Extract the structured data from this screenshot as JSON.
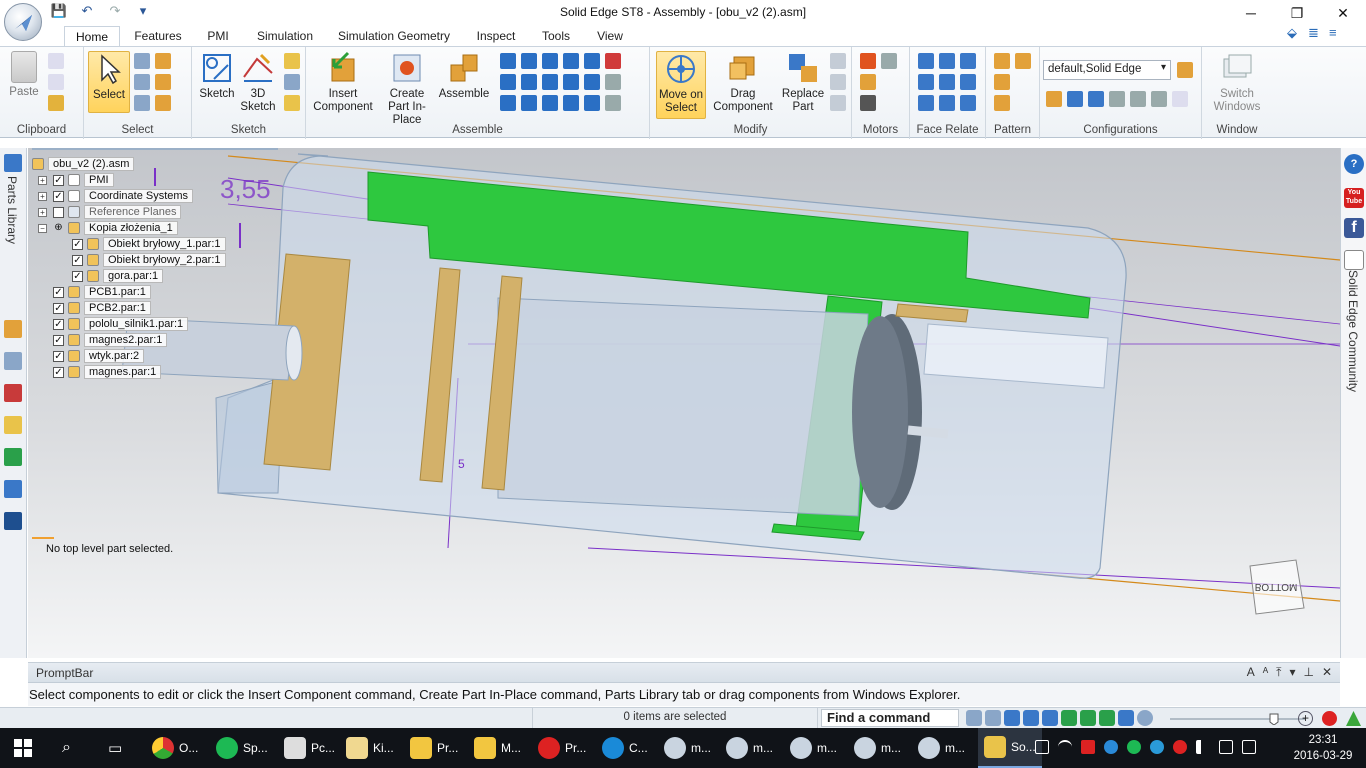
{
  "window": {
    "title": "Solid Edge ST8 - Assembly - [obu_v2 (2).asm]",
    "minimize": "─",
    "restore": "❐",
    "close": "✕"
  },
  "qat": {
    "save": "💾",
    "undo": "↶",
    "redo": "↷",
    "more": "▾"
  },
  "tabs": [
    "Home",
    "Features",
    "PMI",
    "Simulation",
    "Simulation Geometry",
    "Inspect",
    "Tools",
    "View"
  ],
  "ribbon": {
    "clipboard": {
      "paste": "Paste",
      "label": "Clipboard"
    },
    "select": {
      "select": "Select",
      "label": "Select"
    },
    "sketch": {
      "sketch": "Sketch",
      "sketch3d": "3D Sketch",
      "label": "Sketch"
    },
    "assemble": {
      "insert": "Insert Component",
      "create": "Create Part In-Place",
      "assemble": "Assemble",
      "label": "Assemble"
    },
    "modify": {
      "move": "Move on Select",
      "drag": "Drag Component",
      "replace": "Replace Part",
      "label": "Modify"
    },
    "motors": {
      "label": "Motors"
    },
    "face_relate": {
      "label": "Face Relate"
    },
    "pattern": {
      "label": "Pattern"
    },
    "configurations": {
      "value": "default,Solid Edge",
      "label": "Configurations"
    },
    "window": {
      "switch": "Switch Windows",
      "label": "Window"
    }
  },
  "left_bar": {
    "parts_library": "Parts Library"
  },
  "right_bar": {
    "community": "Solid Edge Community",
    "youtube": "You Tube",
    "facebook": "f",
    "help": "?"
  },
  "tree": {
    "root": "obu_v2 (2).asm",
    "items": [
      {
        "label": "PMI",
        "checked": true
      },
      {
        "label": "Coordinate Systems",
        "checked": true
      },
      {
        "label": "Reference Planes",
        "checked": false
      },
      {
        "label": "Kopia złożenia_1",
        "checked": true
      },
      {
        "label": "Obiekt bryłowy_1.par:1",
        "checked": true
      },
      {
        "label": "Obiekt bryłowy_2.par:1",
        "checked": true
      },
      {
        "label": "gora.par:1",
        "checked": true
      },
      {
        "label": "PCB1.par:1",
        "checked": true
      },
      {
        "label": "PCB2.par:1",
        "checked": true
      },
      {
        "label": "pololu_silnik1.par:1",
        "checked": true
      },
      {
        "label": "magnes2.par:1",
        "checked": true
      },
      {
        "label": "wtyk.par:2",
        "checked": true
      },
      {
        "label": "magnes.par:1",
        "checked": true
      }
    ]
  },
  "viewport": {
    "dimension": "3,55",
    "dimension2": "5",
    "status": "No top level part selected.",
    "view_cube": "BOTTOM"
  },
  "promptbar": {
    "title": "PromptBar",
    "message": "Select components to edit or click the Insert Component command, Create Part In-Place command, Parts Library tab or drag components from Windows Explorer.",
    "tools": [
      "A",
      "ᴬ",
      "⤒",
      "▾",
      "⊥",
      "✕"
    ]
  },
  "statusbar": {
    "selection": "0 items are selected",
    "find": "Find a command"
  },
  "taskbar": {
    "apps": [
      "O...",
      "Sp...",
      "Pc...",
      "Ki...",
      "Pr...",
      "M...",
      "Pr...",
      "C...",
      "m...",
      "m...",
      "m...",
      "m...",
      "m...",
      "So..."
    ],
    "time": "23:31",
    "date": "2016-03-29"
  },
  "colors": {
    "accent": "#2b5797",
    "highlight": "#ffd35c",
    "green_part": "#2ec83f",
    "wood": "#d3b16a",
    "dimension": "#7a30c8"
  }
}
